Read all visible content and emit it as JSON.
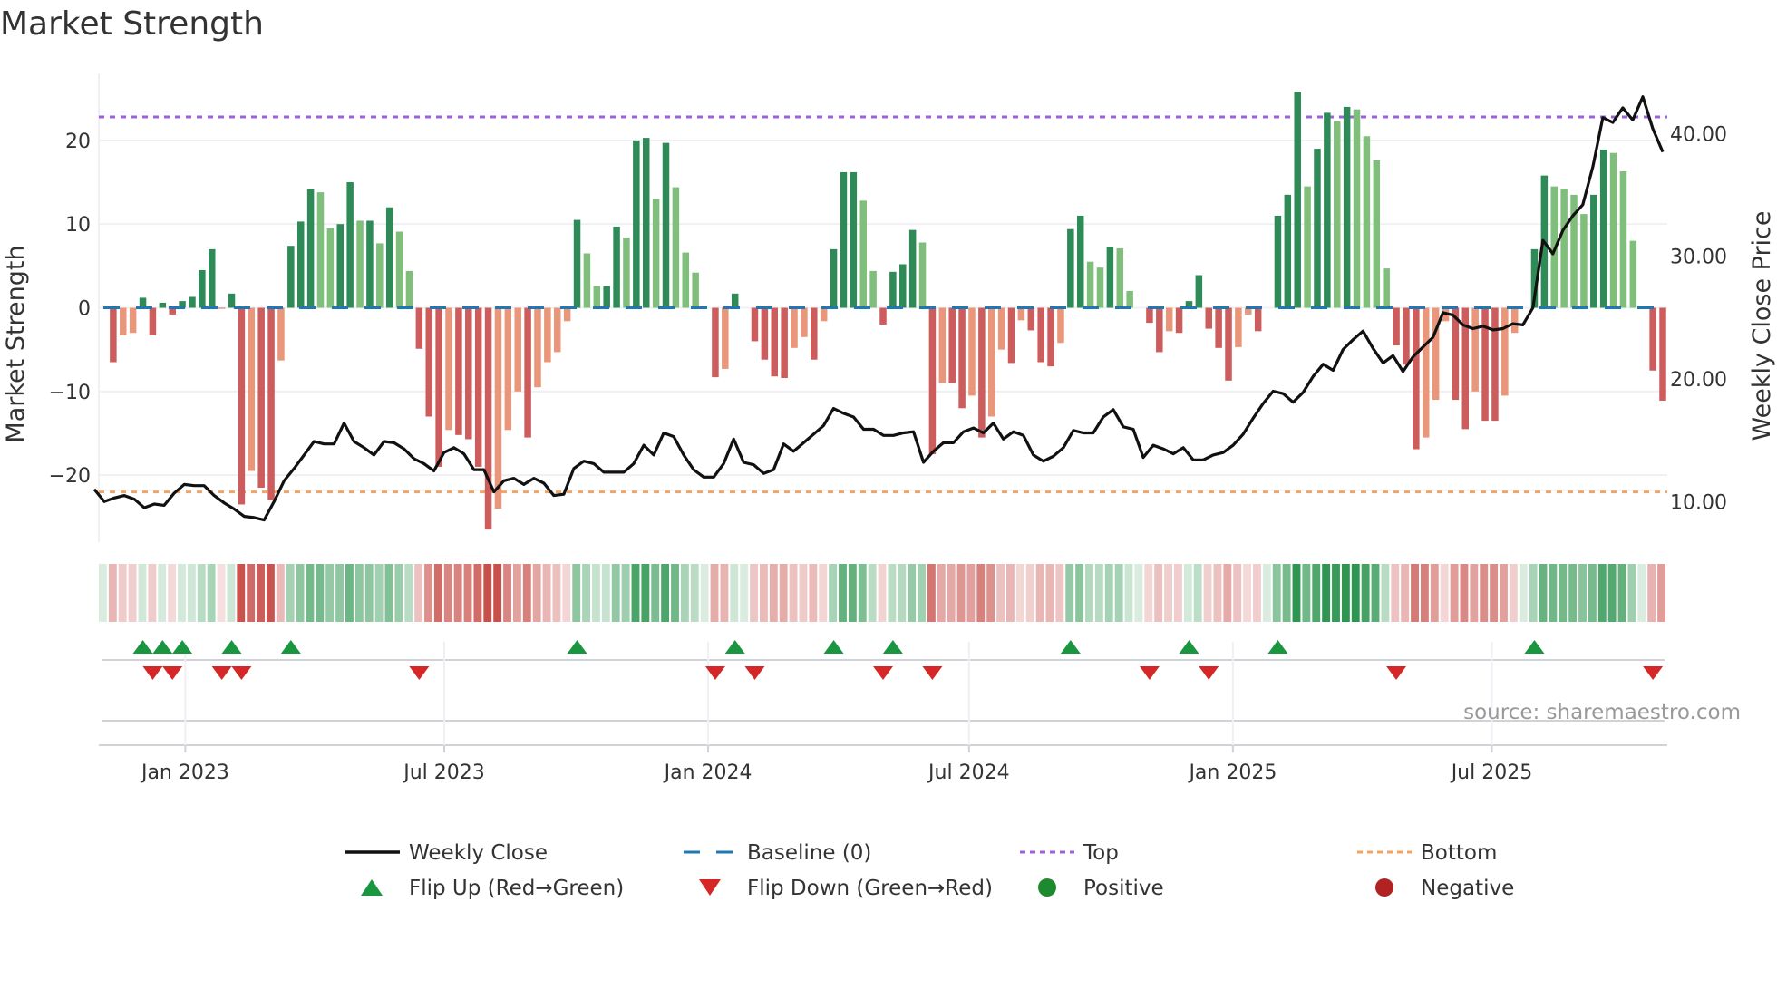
{
  "chart_data": {
    "type": "bar",
    "title": "Market Strength",
    "ylabel": "Market Strength",
    "y2label": "Weekly Close Price",
    "ylim": [
      -28,
      28
    ],
    "y2lim": [
      6.7,
      44.9
    ],
    "yticks": [
      -20,
      -10,
      0,
      10,
      20
    ],
    "yticklabels": [
      "−20",
      "−10",
      "0",
      "10",
      "20"
    ],
    "y2ticks": [
      10,
      20,
      30,
      40
    ],
    "y2ticklabels": [
      "10.00",
      "20.00",
      "30.00",
      "40.00"
    ],
    "top_level": 22.8,
    "bottom_level": -22,
    "x_unit": "week index",
    "xticks": [
      {
        "label": "Jan 2023",
        "week": 8.2
      },
      {
        "label": "Jul 2023",
        "week": 34.1
      },
      {
        "label": "Jan 2024",
        "week": 60.5
      },
      {
        "label": "Jul 2024",
        "week": 86.6
      },
      {
        "label": "Jan 2025",
        "week": 113
      },
      {
        "label": "Jul 2025",
        "week": 138.9
      }
    ],
    "week_count": 157,
    "strength": [
      0,
      -6.5,
      -3.3,
      -3,
      1.2,
      -3.3,
      0.6,
      -0.8,
      0.8,
      1.3,
      4.5,
      7,
      -0.1,
      1.7,
      -23.5,
      -19.5,
      -21.5,
      -23,
      -6.3,
      7.4,
      10.3,
      14.2,
      13.8,
      9.5,
      10,
      15,
      10.4,
      10.4,
      7.7,
      12,
      9.1,
      4.4,
      -4.9,
      -13,
      -19,
      -14.6,
      -15.2,
      -15.7,
      -19,
      -26.5,
      -24,
      -14.6,
      -10,
      -15.5,
      -9.5,
      -6.5,
      -5.3,
      -1.6,
      10.5,
      6.5,
      2.6,
      2.6,
      9.7,
      8.4,
      20,
      20.3,
      13,
      19.7,
      14.4,
      6.6,
      4.2,
      0,
      -8.3,
      -7.3,
      1.7,
      0,
      -4,
      -6.2,
      -8.2,
      -8.4,
      -4.8,
      -3.5,
      -6.2,
      -1.6,
      7,
      16.2,
      16.2,
      12.8,
      4.4,
      -2,
      4.3,
      5.2,
      9.3,
      7.8,
      -17.5,
      -9,
      -9,
      -12,
      -10.5,
      -15.5,
      -13,
      -5,
      -6.6,
      -1.5,
      -2.7,
      -6.5,
      -7,
      -4.2,
      9.4,
      11,
      5.5,
      4.8,
      7.3,
      7.1,
      2,
      0,
      -1.8,
      -5.3,
      -2.8,
      -3,
      0.8,
      3.9,
      -2.5,
      -4.8,
      -8.7,
      -4.7,
      -0.8,
      -2.8,
      0,
      11,
      13.5,
      25.8,
      14.5,
      19,
      23.3,
      22.3,
      24,
      23.7,
      20.5,
      17.6,
      4.7,
      -4.5,
      -6.8,
      -16.9,
      -15.5,
      -11,
      -1.6,
      -11,
      -14.5,
      -10,
      -13.5,
      -13.5,
      -10.5,
      -3,
      0,
      7,
      15.8,
      14.5,
      14.2,
      13.5,
      11.2,
      13.5,
      18.9,
      18.5,
      16.3,
      8,
      0,
      -7.5,
      -11.1
    ],
    "weekly_close": [
      11.0,
      10.0,
      10.3,
      10.5,
      10.2,
      9.5,
      9.8,
      9.7,
      10.7,
      11.4,
      11.3,
      11.3,
      10.5,
      9.9,
      9.4,
      8.8,
      8.7,
      8.5,
      10.0,
      11.7,
      12.7,
      13.8,
      14.9,
      14.7,
      14.7,
      16.4,
      14.9,
      14.4,
      13.8,
      14.9,
      14.8,
      14.3,
      13.5,
      13.1,
      12.5,
      14.0,
      14.4,
      13.9,
      12.6,
      12.6,
      10.8,
      11.7,
      11.9,
      11.4,
      11.9,
      11.5,
      10.5,
      10.6,
      12.7,
      13.3,
      13.1,
      12.4,
      12.4,
      12.4,
      13.1,
      14.6,
      13.8,
      15.6,
      15.3,
      13.8,
      12.6,
      12.0,
      12.0,
      13.1,
      15.1,
      13.2,
      13.0,
      12.3,
      12.6,
      14.7,
      14.1,
      14.8,
      15.5,
      16.2,
      17.6,
      17.2,
      16.9,
      15.9,
      15.9,
      15.4,
      15.4,
      15.6,
      15.7,
      13.2,
      14.1,
      14.8,
      14.8,
      15.7,
      16.0,
      15.6,
      16.4,
      15.1,
      15.7,
      15.4,
      13.8,
      13.3,
      13.7,
      14.4,
      15.8,
      15.6,
      15.6,
      16.9,
      17.5,
      16.1,
      15.9,
      13.6,
      14.6,
      14.3,
      13.9,
      14.4,
      13.4,
      13.4,
      13.8,
      14.0,
      14.6,
      15.5,
      16.8,
      18.0,
      19.0,
      18.8,
      18.1,
      18.9,
      20.2,
      21.2,
      20.7,
      22.4,
      23.2,
      23.9,
      22.5,
      21.3,
      21.9,
      20.6,
      21.8,
      22.6,
      23.4,
      25.4,
      25.2,
      24.4,
      24.1,
      24.3,
      24.0,
      24.1,
      24.5,
      24.4,
      25.8,
      31.3,
      30.2,
      32.1,
      33.3,
      34.2,
      37.3,
      41.3,
      40.9,
      42.1,
      41.1,
      43.0,
      40.4,
      38.5
    ],
    "legend": [
      {
        "label": "Weekly Close",
        "kind": "line",
        "color": "#111111"
      },
      {
        "label": "Baseline (0)",
        "kind": "dash",
        "color": "#1f77b4"
      },
      {
        "label": "Top",
        "kind": "dot",
        "color": "#9b5fe0"
      },
      {
        "label": "Bottom",
        "kind": "dot",
        "color": "#f4a460"
      },
      {
        "label": "Flip Up (Red→Green)",
        "kind": "tri-up",
        "color": "#1a9641"
      },
      {
        "label": "Flip Down (Green→Red)",
        "kind": "tri-down",
        "color": "#d62728"
      },
      {
        "label": "Positive",
        "kind": "circle",
        "color": "#1e8a2e"
      },
      {
        "label": "Negative",
        "kind": "circle",
        "color": "#b22222"
      }
    ],
    "source": "source: sharemaestro.com",
    "colors": {
      "pos_strong": "#2e8b57",
      "pos_weak": "#7fbf7b",
      "neg_strong": "#cd5c5c",
      "neg_weak": "#e9967a"
    }
  }
}
